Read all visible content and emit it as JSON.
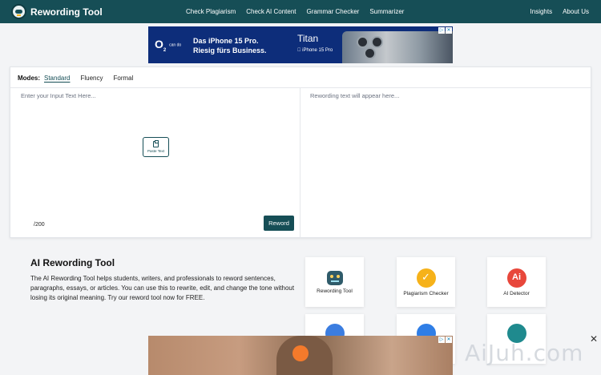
{
  "header": {
    "logo_text": "Rewording Tool",
    "nav_main": [
      "Check Plagiarism",
      "Check AI Content",
      "Grammar Checker",
      "Summarizer"
    ],
    "nav_right": [
      "Insights",
      "About Us"
    ],
    "bg_color": "#164e56"
  },
  "ad_top": {
    "brand": "O",
    "brand_sub": "can do",
    "headline": "Das iPhone 15 Pro.\nRiesig fürs Business.",
    "product_title": "Titan",
    "product_sub": "iPhone 15 Pro"
  },
  "editor": {
    "modes_label": "Modes:",
    "modes": [
      "Standard",
      "Fluency",
      "Formal"
    ],
    "active_mode": "Standard",
    "input_placeholder": "Enter your Input Text Here...",
    "output_placeholder": "Rewording text will appear here...",
    "paste_label": "Paste Text",
    "counter": "/200",
    "reword_label": "Reword"
  },
  "info": {
    "title": "AI Rewording Tool",
    "text": "The AI Rewording Tool helps students, writers, and professionals to reword sentences, paragraphs, essays, or articles. You can use this to rewrite, edit, and change the tone without losing its original meaning. Try our reword tool now for FREE."
  },
  "tools": [
    {
      "label": "Rewording Tool",
      "icon": "robot-icon"
    },
    {
      "label": "Plagiarism Checker",
      "icon": "check-icon"
    },
    {
      "label": "AI Detector",
      "icon": "ai-icon"
    }
  ],
  "watermark": "AiJuh.com",
  "close_glyph": "✕"
}
